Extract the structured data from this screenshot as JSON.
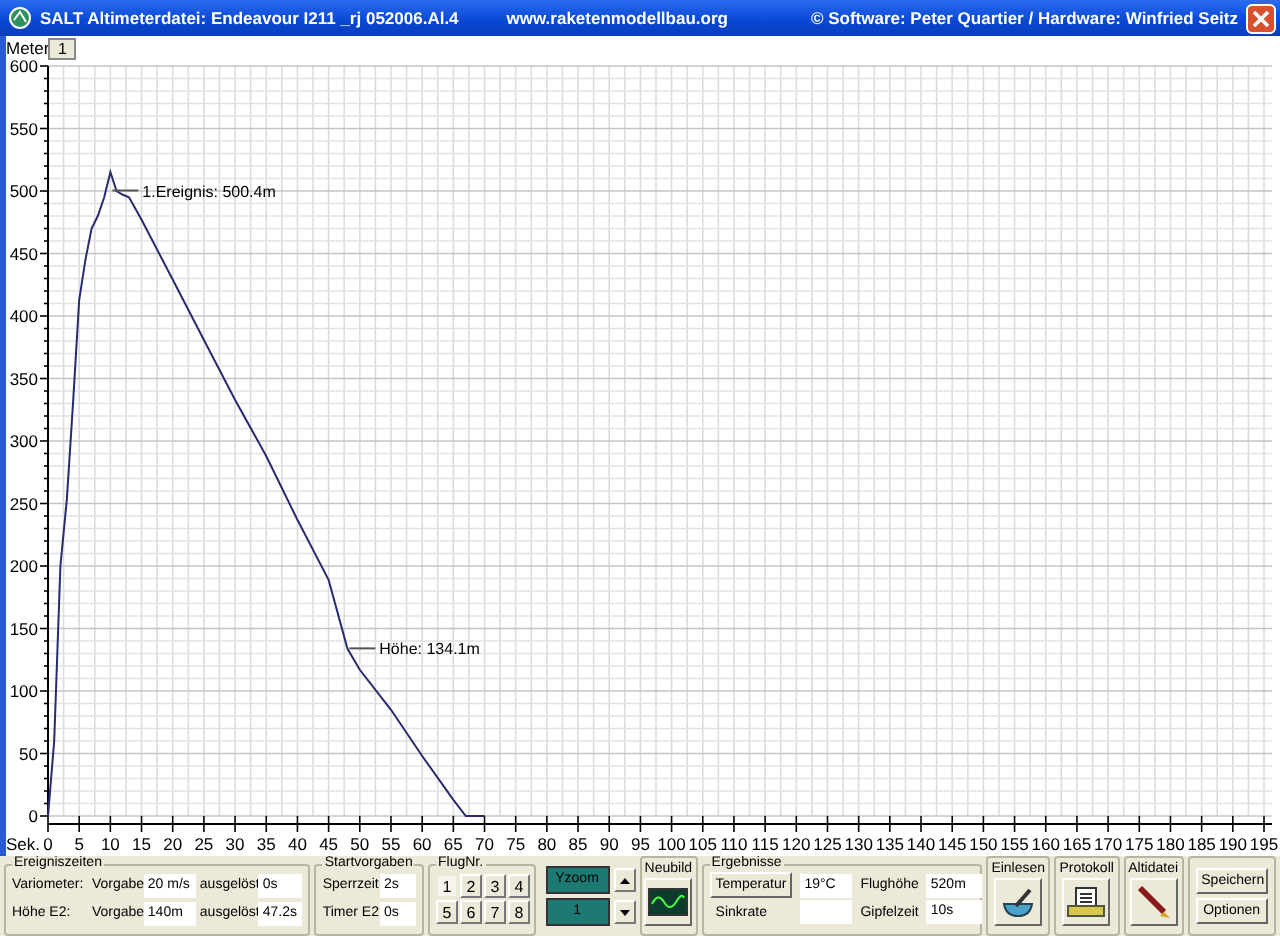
{
  "window": {
    "title": "SALT Altimeterdatei: Endeavour I211 _rj 052006.Al.4",
    "website": "www.raketenmodellbau.org",
    "copyright": "© Software: Peter Quartier / Hardware: Winfried Seitz"
  },
  "chart": {
    "tab": "1",
    "chart_data": {
      "type": "line",
      "xlabel": "Sek.",
      "ylabel": "Meter",
      "x": [
        0,
        1,
        2,
        3,
        4,
        5,
        6,
        7,
        8,
        9,
        10,
        11,
        12,
        13,
        15,
        20,
        25,
        30,
        35,
        40,
        45,
        48,
        50,
        55,
        60,
        65,
        67,
        70
      ],
      "grid": true,
      "series": [
        {
          "color": "#2a2a6e",
          "values": [
            0,
            60,
            200,
            253,
            330,
            413,
            445,
            470,
            480,
            495,
            515,
            500,
            497,
            495,
            477,
            429,
            381,
            333,
            288,
            237,
            189,
            134,
            117,
            85,
            48,
            13,
            0,
            0
          ]
        }
      ],
      "xlim": [
        0,
        195
      ],
      "ylim": [
        0,
        600
      ],
      "xticks": [
        0,
        5,
        10,
        15,
        20,
        25,
        30,
        35,
        40,
        45,
        50,
        55,
        60,
        65,
        70,
        75,
        80,
        85,
        90,
        95,
        100,
        105,
        110,
        115,
        120,
        125,
        130,
        135,
        140,
        145,
        150,
        155,
        160,
        165,
        170,
        175,
        180,
        185,
        190,
        195
      ],
      "yticks": [
        0,
        50,
        100,
        150,
        200,
        250,
        300,
        350,
        400,
        450,
        500,
        550,
        600
      ],
      "annotations": [
        {
          "x": 10,
          "y": 500.4,
          "text": "1.Ereignis: 500.4m"
        },
        {
          "x": 48,
          "y": 134.1,
          "text": "Höhe: 134.1m"
        }
      ]
    }
  },
  "ereigniszeiten": {
    "title": "Ereigniszeiten",
    "rows": [
      {
        "label": "Variometer:",
        "vorgabe_label": "Vorgabe",
        "vorgabe": "20 m/s",
        "ausgeloest_label": "ausgelöst",
        "ausgeloest": "0s"
      },
      {
        "label": "Höhe E2:",
        "vorgabe_label": "Vorgabe",
        "vorgabe": "140m",
        "ausgeloest_label": "ausgelöst",
        "ausgeloest": "47.2s"
      }
    ]
  },
  "startvorgaben": {
    "title": "Startvorgaben",
    "rows": [
      {
        "label": "Sperrzeit",
        "value": "2s"
      },
      {
        "label": "Timer E2",
        "value": "0s"
      }
    ]
  },
  "flugnr": {
    "title": "FlugNr.",
    "buttons": [
      {
        "label": "1",
        "selected": true
      },
      {
        "label": "2",
        "selected": false
      },
      {
        "label": "3",
        "selected": false
      },
      {
        "label": "4",
        "selected": false
      },
      {
        "label": "5",
        "selected": false
      },
      {
        "label": "6",
        "selected": false
      },
      {
        "label": "7",
        "selected": false
      },
      {
        "label": "8",
        "selected": false
      }
    ]
  },
  "yzoom": {
    "label": "Yzoom",
    "value": "1"
  },
  "neubild": {
    "title": "Neubild"
  },
  "ergebnisse": {
    "title": "Ergebnisse",
    "temperatur_button": "Temperatur",
    "temperatur": "19°C",
    "sinkrate_label": "Sinkrate",
    "flughoehe_label": "Flughöhe",
    "flughoehe": "520m",
    "gipfelzeit_label": "Gipfelzeit",
    "gipfelzeit": "10s"
  },
  "actions": [
    {
      "kind": "einlesen",
      "title": "Einlesen"
    },
    {
      "kind": "protokoll",
      "title": "Protokoll"
    },
    {
      "kind": "altidatei",
      "title": "Altidatei"
    }
  ],
  "buttons": [
    "Speichern",
    "Optionen"
  ]
}
